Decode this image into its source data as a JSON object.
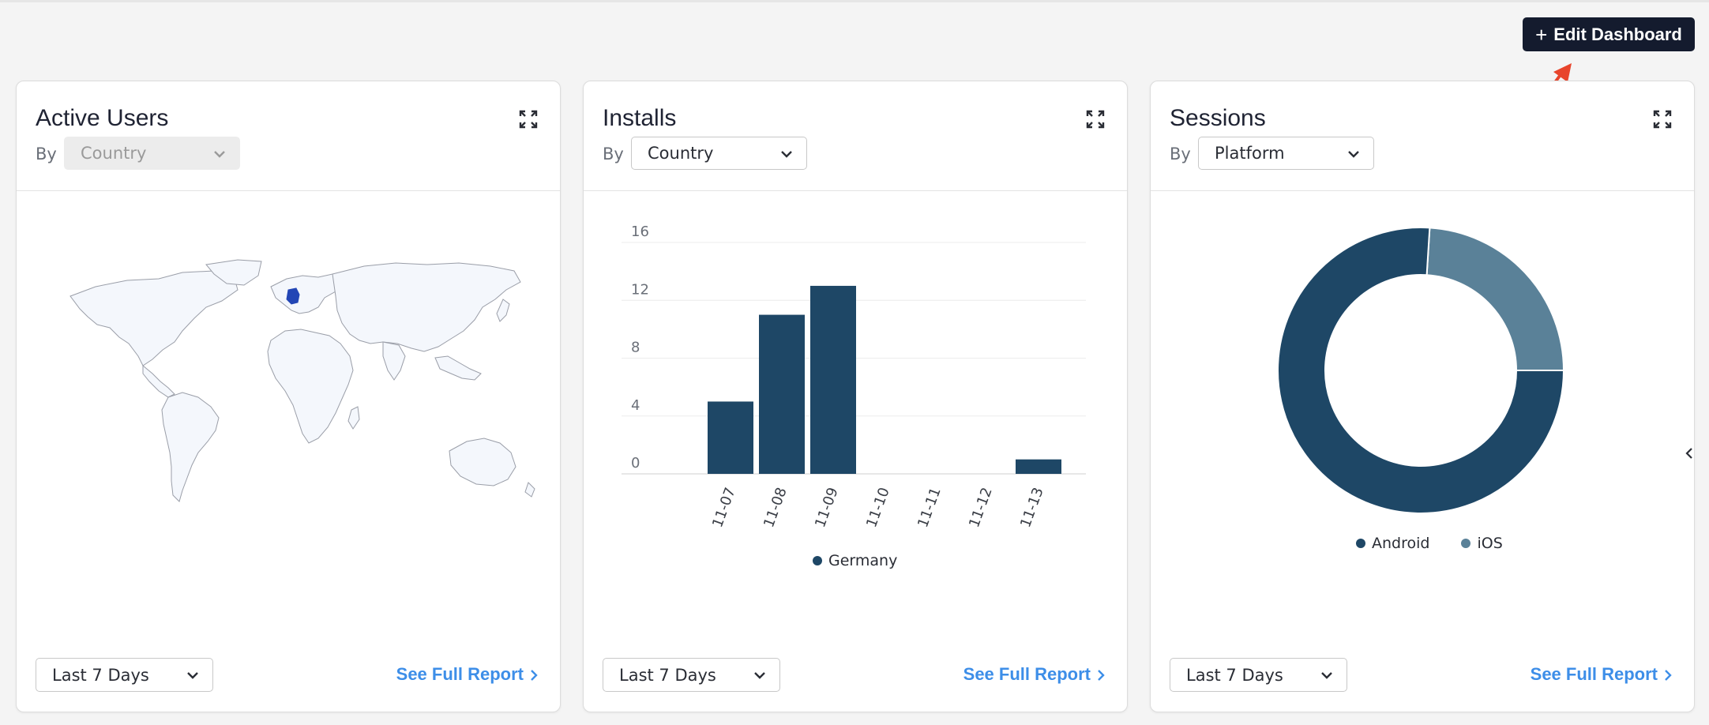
{
  "header": {
    "edit_button_label": "Edit Dashboard",
    "edit_button_icon": "plus-icon",
    "annotation_color": "#e8452c"
  },
  "cards": [
    {
      "title": "Active Users",
      "by_label": "By",
      "dimension": "Country",
      "dimension_disabled": true,
      "visual": "world-map",
      "highlighted_country": "Germany",
      "range": "Last 7 Days",
      "report_link": "See Full Report"
    },
    {
      "title": "Installs",
      "by_label": "By",
      "dimension": "Country",
      "visual": "bar-chart",
      "range": "Last 7 Days",
      "report_link": "See Full Report"
    },
    {
      "title": "Sessions",
      "by_label": "By",
      "dimension": "Platform",
      "visual": "donut-chart",
      "range": "Last 7 Days",
      "report_link": "See Full Report"
    }
  ],
  "colors": {
    "primary": "#1e4766",
    "secondary": "#5a8198",
    "link": "#3d8ee8",
    "button_dark": "#141b2e",
    "map_highlight": "#2346b5"
  },
  "chart_data": [
    {
      "type": "bar",
      "categories": [
        "11-07",
        "11-08",
        "11-09",
        "11-10",
        "11-11",
        "11-12",
        "11-13"
      ],
      "series": [
        {
          "name": "Germany",
          "values": [
            5,
            11,
            13,
            0,
            0,
            0,
            1
          ]
        }
      ],
      "yticks": [
        "0",
        "4",
        "8",
        "12",
        "16"
      ],
      "ylim": [
        0,
        16
      ],
      "grid": true,
      "legend": "bottom"
    },
    {
      "type": "pie",
      "style": "donut",
      "labels": [
        "Android",
        "iOS"
      ],
      "values": [
        76,
        24
      ],
      "legend": "bottom"
    }
  ]
}
